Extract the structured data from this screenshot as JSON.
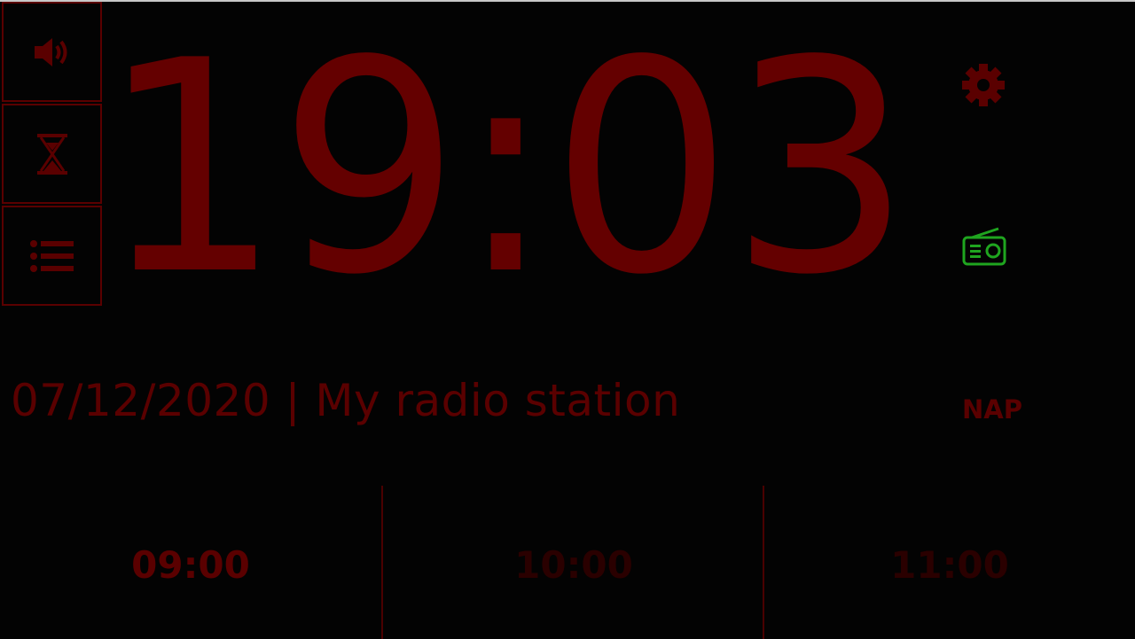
{
  "colors": {
    "background": "#030303",
    "clock_red": "#640000",
    "dim_red": "#5a0000",
    "inactive_red": "#2a0000",
    "radio_green": "#1fa51f"
  },
  "sidebar": {
    "buttons": [
      {
        "name": "volume",
        "icon": "speaker-icon"
      },
      {
        "name": "sleep-timer",
        "icon": "hourglass-icon"
      },
      {
        "name": "menu",
        "icon": "list-icon"
      }
    ]
  },
  "clock": {
    "time": "19:03"
  },
  "info_line": "07/12/2020 | My radio station",
  "right_panel": {
    "settings_icon": "gear-icon",
    "radio_icon": "radio-icon",
    "nap_label": "NAP"
  },
  "alarms": [
    {
      "time": "09:00",
      "active": true
    },
    {
      "time": "10:00",
      "active": false
    },
    {
      "time": "11:00",
      "active": false
    }
  ]
}
